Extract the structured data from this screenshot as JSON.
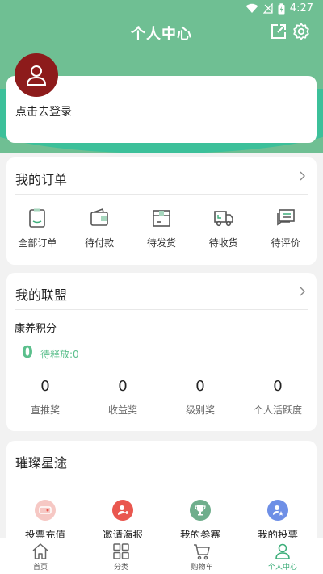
{
  "status_bar": {
    "time": "4:27"
  },
  "header": {
    "title": "个人中心"
  },
  "login": {
    "text": "点击去登录"
  },
  "orders": {
    "title": "我的订单",
    "items": [
      {
        "label": "全部订单",
        "icon": "clipboard-icon"
      },
      {
        "label": "待付款",
        "icon": "wallet-icon"
      },
      {
        "label": "待发货",
        "icon": "package-icon"
      },
      {
        "label": "待收货",
        "icon": "truck-icon"
      },
      {
        "label": "待评价",
        "icon": "comment-icon"
      }
    ]
  },
  "alliance": {
    "title": "我的联盟",
    "points_label": "康养积分",
    "points_value": "0",
    "pending": "待释放:0",
    "stats": [
      {
        "value": "0",
        "label": "直推奖"
      },
      {
        "value": "0",
        "label": "收益奖"
      },
      {
        "value": "0",
        "label": "级别奖"
      },
      {
        "value": "0",
        "label": "个人活跃度"
      }
    ]
  },
  "stars": {
    "title": "璀璨星途",
    "items": [
      {
        "label": "投票充值",
        "icon": "ticket-icon",
        "color": "#f6c8c4"
      },
      {
        "label": "邀请海报",
        "icon": "invite-icon",
        "color": "#e9574f"
      },
      {
        "label": "我的参赛",
        "icon": "trophy-icon",
        "color": "#6fae8c"
      },
      {
        "label": "我的投票",
        "icon": "vote-icon",
        "color": "#6e8fe6"
      }
    ]
  },
  "tabbar": {
    "items": [
      {
        "label": "首页",
        "icon": "home-icon"
      },
      {
        "label": "分类",
        "icon": "grid-icon"
      },
      {
        "label": "购物车",
        "icon": "cart-icon"
      },
      {
        "label": "个人中心",
        "icon": "person-icon",
        "active": true
      }
    ]
  },
  "colors": {
    "accent": "#3dae7a",
    "hero": "#6fbf93",
    "avatar": "#8d1b1b"
  }
}
